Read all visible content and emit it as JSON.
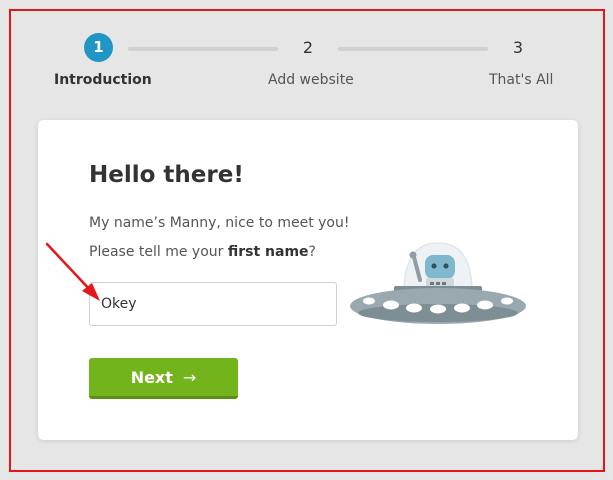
{
  "steps": [
    {
      "number": "1",
      "label": "Introduction"
    },
    {
      "number": "2",
      "label": "Add website"
    },
    {
      "number": "3",
      "label": "That's All"
    }
  ],
  "card": {
    "heading": "Hello there!",
    "intro": "My name’s Manny, nice to meet you!",
    "ask_prefix": "Please tell me your ",
    "ask_bold": "first name",
    "ask_suffix": "?",
    "input_value": "Okey",
    "next_label": "Next",
    "next_arrow": "→"
  },
  "colors": {
    "accent": "#1f96c5",
    "button": "#73b41c",
    "annotation": "#e4161b"
  },
  "icons": {
    "mascot": "ufo-robot-icon",
    "annotation": "red-arrow-icon"
  }
}
